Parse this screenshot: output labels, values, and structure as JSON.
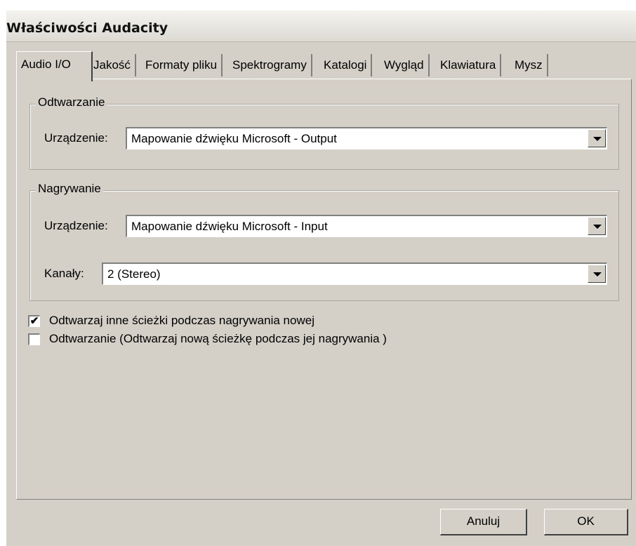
{
  "window": {
    "title": "Właściwości Audacity"
  },
  "tabs": [
    {
      "label": "Audio I/O",
      "active": true
    },
    {
      "label": "Jakość"
    },
    {
      "label": "Formaty pliku"
    },
    {
      "label": "Spektrogramy"
    },
    {
      "label": "Katalogi"
    },
    {
      "label": "Wygląd"
    },
    {
      "label": "Klawiatura"
    },
    {
      "label": "Mysz"
    }
  ],
  "playback": {
    "legend": "Odtwarzanie",
    "device_label": "Urządzenie:",
    "device_value": "Mapowanie dźwięku Microsoft - Output"
  },
  "recording": {
    "legend": "Nagrywanie",
    "device_label": "Urządzenie:",
    "device_value": "Mapowanie dźwięku Microsoft - Input",
    "channels_label": "Kanały:",
    "channels_value": "2 (Stereo)"
  },
  "options": [
    {
      "label": "Odtwarzaj inne ścieżki podczas nagrywania nowej",
      "checked": true,
      "mark": "✔"
    },
    {
      "label": "Odtwarzanie (Odtwarzaj nową ścieżkę podczas jej nagrywania )",
      "checked": false,
      "mark": ""
    }
  ],
  "buttons": {
    "cancel": "Anuluj",
    "ok": "OK"
  }
}
